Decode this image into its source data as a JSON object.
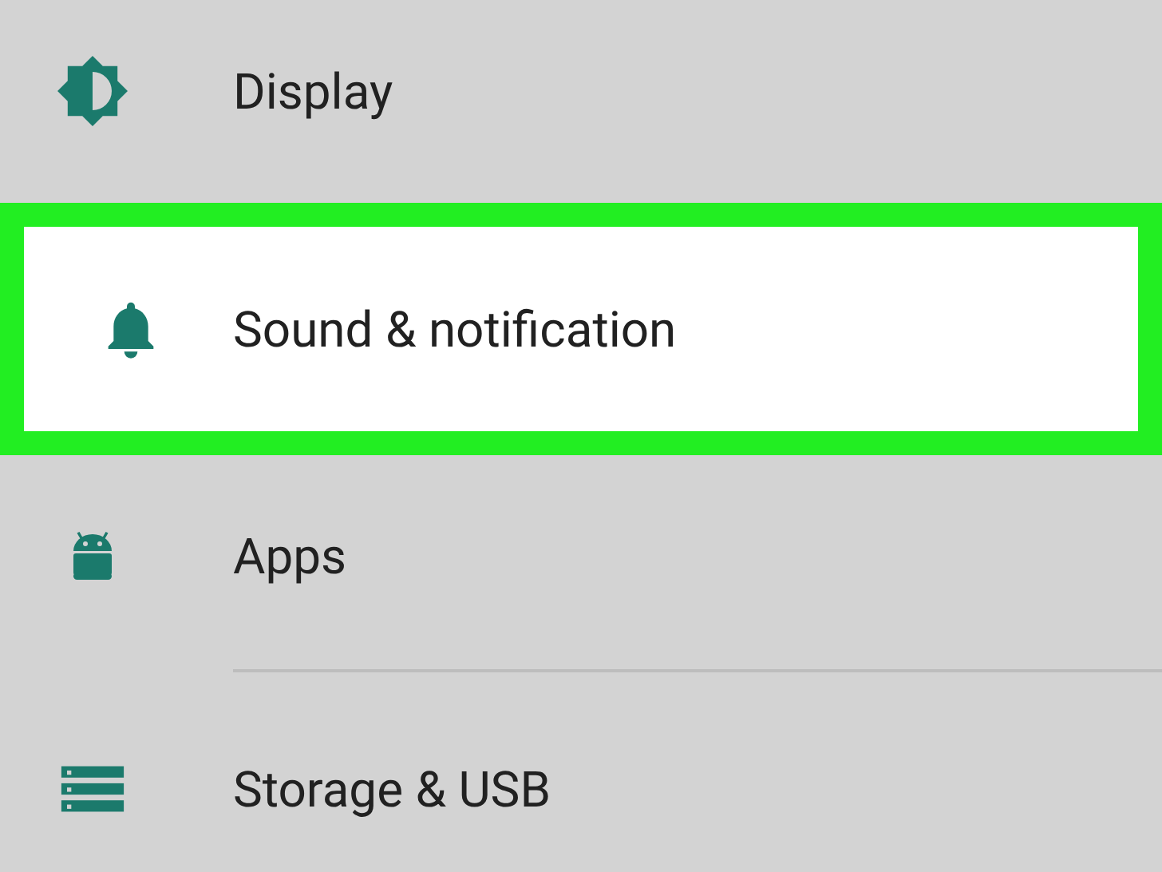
{
  "settings": [
    {
      "label": "Display",
      "selected": false,
      "divider_below": false
    },
    {
      "label": "Sound & notification",
      "selected": true,
      "divider_below": false
    },
    {
      "label": "Apps",
      "selected": false,
      "divider_below": true
    },
    {
      "label": "Storage & USB",
      "selected": false,
      "divider_below": false
    }
  ]
}
